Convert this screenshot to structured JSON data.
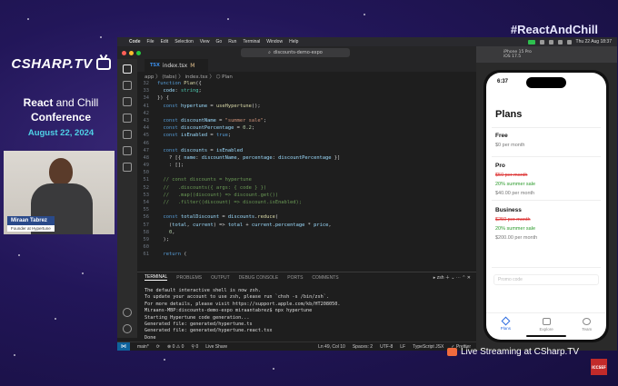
{
  "branding": {
    "logo_text": "CSHARP.TV",
    "conference_line1_a": "React",
    "conference_line1_b": "and Chill",
    "conference_line2": "Conference",
    "date": "August 22, 2024",
    "hashtag": "#ReactAndChill",
    "live_text": "Live Streaming at CSharp.TV",
    "corner_logo": "ICCSEF"
  },
  "speaker": {
    "name": "Miraan Tabrez",
    "role": "Founder at Hypertune"
  },
  "mac_menubar": {
    "apple": "",
    "items": [
      "Code",
      "File",
      "Edit",
      "Selection",
      "View",
      "Go",
      "Run",
      "Terminal",
      "Window",
      "Help"
    ],
    "clock": "Thu 22 Aug 18:37"
  },
  "vscode": {
    "search_text": "discounts-demo-expo",
    "tab_label": "index.tsx",
    "tab_badge": "TSX",
    "tab_status": "M",
    "breadcrumb": "app 〉 (tabs) 〉 index.tsx 〉 ⬡ Plan",
    "code_lines": [
      {
        "n": "32",
        "parts": [
          [
            "kw",
            "function "
          ],
          [
            "fn",
            "Plan"
          ],
          [
            "code",
            "({"
          ]
        ]
      },
      {
        "n": "33",
        "parts": [
          [
            "vr",
            "  code"
          ],
          [
            "code",
            ": "
          ],
          [
            "ty",
            "string"
          ],
          [
            "code",
            ";"
          ]
        ]
      },
      {
        "n": "34",
        "parts": [
          [
            "code",
            "}) {"
          ]
        ]
      },
      {
        "n": "41",
        "parts": [
          [
            "kw",
            "  const "
          ],
          [
            "vr",
            "hypertune"
          ],
          [
            "code",
            " = "
          ],
          [
            "fn",
            "useHypertune"
          ],
          [
            "code",
            "();"
          ]
        ]
      },
      {
        "n": "42",
        "parts": [
          [
            "code",
            ""
          ]
        ]
      },
      {
        "n": "43",
        "parts": [
          [
            "kw",
            "  const "
          ],
          [
            "vr",
            "discountName"
          ],
          [
            "code",
            " = "
          ],
          [
            "st",
            "\"summer sale\""
          ],
          [
            "code",
            ";"
          ]
        ]
      },
      {
        "n": "44",
        "parts": [
          [
            "kw",
            "  const "
          ],
          [
            "vr",
            "discountPercentage"
          ],
          [
            "code",
            " = "
          ],
          [
            "nm",
            "0.2"
          ],
          [
            "code",
            ";"
          ]
        ]
      },
      {
        "n": "45",
        "parts": [
          [
            "kw",
            "  const "
          ],
          [
            "vr",
            "isEnabled"
          ],
          [
            "code",
            " = "
          ],
          [
            "kw",
            "true"
          ],
          [
            "code",
            ";"
          ]
        ]
      },
      {
        "n": "46",
        "parts": [
          [
            "code",
            ""
          ]
        ]
      },
      {
        "n": "47",
        "parts": [
          [
            "kw",
            "  const "
          ],
          [
            "vr",
            "discounts"
          ],
          [
            "code",
            " = "
          ],
          [
            "vr",
            "isEnabled"
          ]
        ]
      },
      {
        "n": "48",
        "parts": [
          [
            "code",
            "    ? [{ "
          ],
          [
            "vr",
            "name"
          ],
          [
            "code",
            ": "
          ],
          [
            "vr",
            "discountName"
          ],
          [
            "code",
            ", "
          ],
          [
            "vr",
            "percentage"
          ],
          [
            "code",
            ": "
          ],
          [
            "vr",
            "discountPercentage"
          ],
          [
            "code",
            " }]"
          ]
        ]
      },
      {
        "n": "49",
        "parts": [
          [
            "code",
            "    : [];"
          ]
        ]
      },
      {
        "n": "50",
        "parts": [
          [
            "code",
            ""
          ]
        ]
      },
      {
        "n": "51",
        "parts": [
          [
            "cm",
            "  // const discounts = hypertune"
          ]
        ]
      },
      {
        "n": "52",
        "parts": [
          [
            "cm",
            "  //   .discounts({ args: { code } })"
          ]
        ]
      },
      {
        "n": "53",
        "parts": [
          [
            "cm",
            "  //   .map((discount) => discount.get())"
          ]
        ]
      },
      {
        "n": "54",
        "parts": [
          [
            "cm",
            "  //   .filter((discount) => discount.isEnabled);"
          ]
        ]
      },
      {
        "n": "55",
        "parts": [
          [
            "code",
            ""
          ]
        ]
      },
      {
        "n": "56",
        "parts": [
          [
            "kw",
            "  const "
          ],
          [
            "vr",
            "totalDiscount"
          ],
          [
            "code",
            " = "
          ],
          [
            "vr",
            "discounts"
          ],
          [
            "code",
            "."
          ],
          [
            "fn",
            "reduce"
          ],
          [
            "code",
            "("
          ]
        ]
      },
      {
        "n": "57",
        "parts": [
          [
            "code",
            "    ("
          ],
          [
            "vr",
            "total"
          ],
          [
            "code",
            ", "
          ],
          [
            "vr",
            "current"
          ],
          [
            "code",
            ") => "
          ],
          [
            "vr",
            "total"
          ],
          [
            "code",
            " + "
          ],
          [
            "vr",
            "current"
          ],
          [
            "code",
            "."
          ],
          [
            "vr",
            "percentage"
          ],
          [
            "code",
            " * "
          ],
          [
            "vr",
            "price"
          ],
          [
            "code",
            ","
          ]
        ]
      },
      {
        "n": "58",
        "parts": [
          [
            "nm",
            "    0"
          ],
          [
            "code",
            ","
          ]
        ]
      },
      {
        "n": "59",
        "parts": [
          [
            "code",
            "  );"
          ]
        ]
      },
      {
        "n": "60",
        "parts": [
          [
            "code",
            ""
          ]
        ]
      },
      {
        "n": "61",
        "parts": [
          [
            "kw",
            "  return "
          ],
          [
            "code",
            "("
          ]
        ]
      }
    ],
    "panel_tabs": [
      "TERMINAL",
      "PROBLEMS",
      "OUTPUT",
      "DEBUG CONSOLE",
      "PORTS",
      "COMMENTS"
    ],
    "terminal_shell": "zsh",
    "terminal_lines": [
      "The default interactive shell is now zsh.",
      "To update your account to use zsh, please run `chsh -s /bin/zsh`.",
      "For more details, please visit https://support.apple.com/kb/HT208050.",
      "Miraans-MBP:discounts-demo-expo miraantabrez$ npx hypertune",
      "Starting Hypertune code generation...",
      "Generated file: generated/hypertune.ts",
      "Generated file: generated/hypertune.react.tsx",
      "Done",
      "Miraans-MBP:discounts-demo-expo miraantabrez$ ▯"
    ],
    "status": {
      "branch": "main*",
      "sync": "⟳",
      "errors": "⊗ 0 ⚠ 0",
      "ports": "⚲ 0",
      "live_share": "Live Share",
      "position": "Ln 49, Col 10",
      "spaces": "Spaces: 2",
      "encoding": "UTF-8",
      "eol": "LF",
      "language": "TypeScript JSX",
      "prettier": "✓ Prettier"
    }
  },
  "simulator": {
    "device": "iPhone 15 Pro",
    "os": "iOS 17.5",
    "time": "6:37",
    "title": "Plans",
    "plans": [
      {
        "name": "Free",
        "rows": [
          {
            "text": "$0 per month",
            "style": "normal"
          }
        ]
      },
      {
        "name": "Pro",
        "rows": [
          {
            "text": "$50 per month",
            "style": "strike"
          },
          {
            "text": "20% summer sale",
            "style": "promo"
          },
          {
            "text": "$40.00 per month",
            "style": "normal"
          }
        ]
      },
      {
        "name": "Business",
        "rows": [
          {
            "text": "$250 per month",
            "style": "strike"
          },
          {
            "text": "20% summer sale",
            "style": "promo"
          },
          {
            "text": "$200.00 per month",
            "style": "normal"
          }
        ]
      }
    ],
    "promo_placeholder": "Promo code",
    "tabs": [
      "Plans",
      "Explore",
      "Team"
    ]
  }
}
